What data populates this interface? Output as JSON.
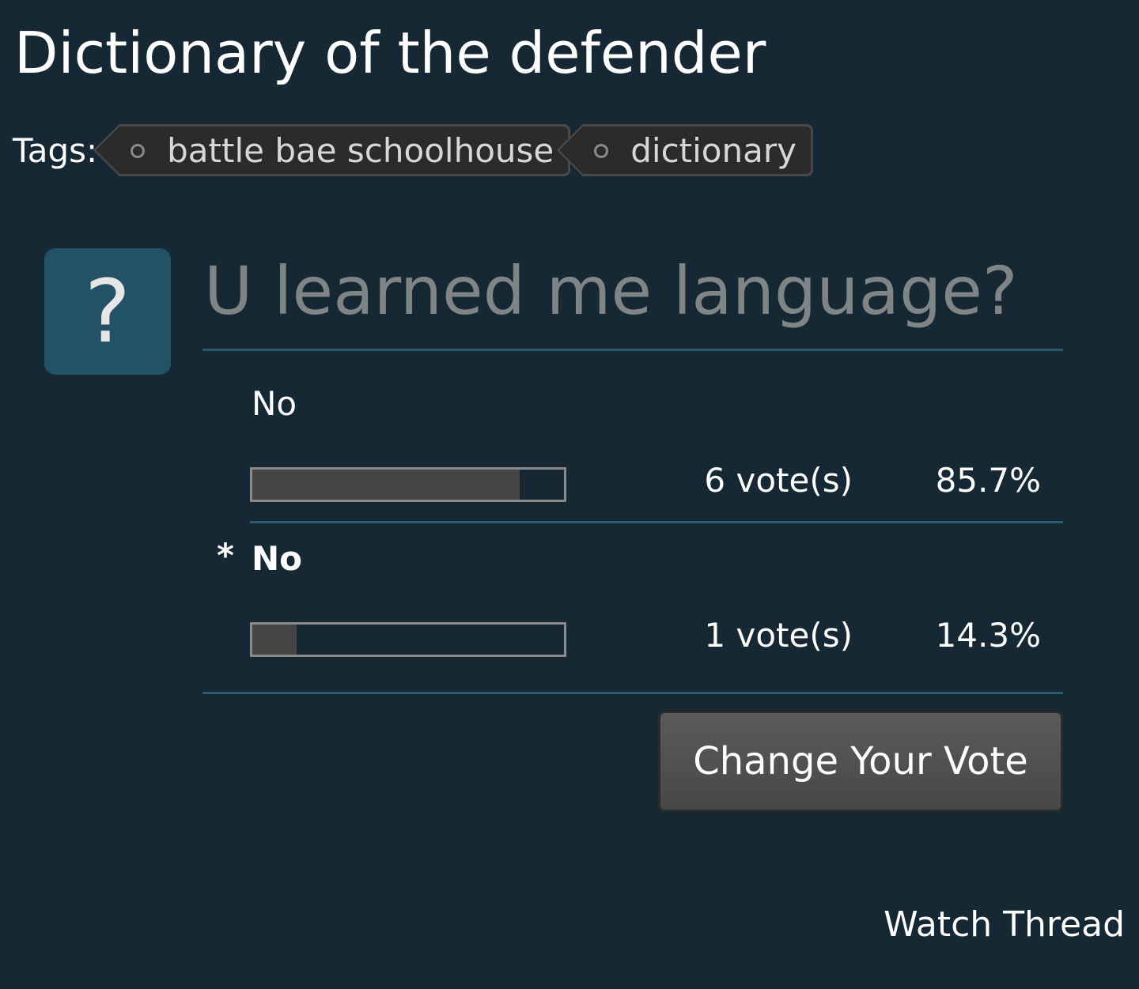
{
  "thread": {
    "title": "Dictionary of the defender"
  },
  "tags": {
    "label": "Tags:",
    "items": [
      "battle bae schoolhouse",
      "dictionary"
    ]
  },
  "poll": {
    "icon": "question-mark-icon",
    "icon_glyph": "?",
    "question": "U learned me language?",
    "responses": [
      {
        "text": "No",
        "voted_marker": "",
        "votes_label": "6 vote(s)",
        "percent_label": "85.7%",
        "fraction": 0.857,
        "voted": false
      },
      {
        "text": "No",
        "voted_marker": "*",
        "votes_label": "1 vote(s)",
        "percent_label": "14.3%",
        "fraction": 0.143,
        "voted": true
      }
    ],
    "change_vote_label": "Change Your Vote"
  },
  "actions": {
    "watch_thread_label": "Watch Thread"
  },
  "colors": {
    "background": "#152833",
    "accent": "#235266",
    "divider": "#2a5a70",
    "bar_fill": "#454545",
    "muted_text": "#7f8486"
  }
}
